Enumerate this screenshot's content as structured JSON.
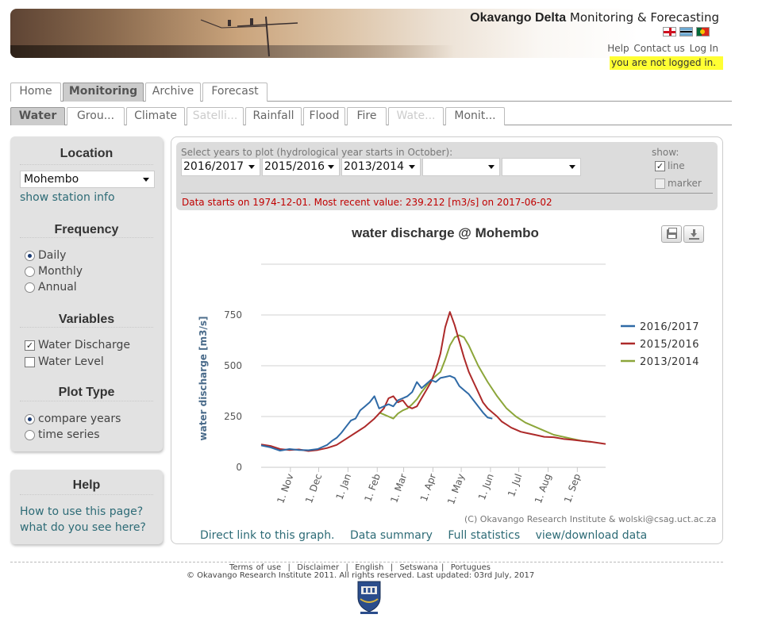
{
  "header": {
    "title_bold": "Okavango Delta",
    "title_rest": "Monitoring & Forecasting",
    "links": [
      "Help",
      "Contact us",
      "Log In"
    ],
    "login_status": "you are not logged in.",
    "flags": [
      "english-flag",
      "botswana-flag",
      "portugal-flag"
    ]
  },
  "main_tabs": [
    "Home",
    "Monitoring",
    "Archive",
    "Forecast"
  ],
  "main_tab_active": "Monitoring",
  "sub_tabs": [
    "Water",
    "Grou...",
    "Climate",
    "Satelli...",
    "Rainfall",
    "Flood",
    "Fire",
    "Wate...",
    "Monit..."
  ],
  "sub_tab_active": "Water",
  "sub_tabs_disabled": [
    "Satelli...",
    "Wate..."
  ],
  "sidebar": {
    "location": {
      "heading": "Location",
      "selected": "Mohembo",
      "link": "show station info"
    },
    "frequency": {
      "heading": "Frequency",
      "options": [
        "Daily",
        "Monthly",
        "Annual"
      ],
      "selected": "Daily"
    },
    "variables": {
      "heading": "Variables",
      "options": [
        {
          "label": "Water Discharge",
          "checked": true
        },
        {
          "label": "Water Level",
          "checked": false
        }
      ]
    },
    "plot_type": {
      "heading": "Plot Type",
      "options": [
        "compare years",
        "time series"
      ],
      "selected": "compare years"
    },
    "help": {
      "heading": "Help",
      "links": [
        "How to use this page?",
        "what do you see here?"
      ]
    }
  },
  "controls": {
    "label": "Select years to plot (hydrological year starts in October):",
    "years": [
      "2016/2017",
      "2015/2016",
      "2013/2014",
      "",
      ""
    ],
    "show_label": "show:",
    "show_options": [
      {
        "label": "line",
        "checked": true
      },
      {
        "label": "marker",
        "checked": false
      }
    ],
    "data_info": "Data starts on 1974-12-01. Most recent value: 239.212 [m3/s] on 2017-06-02"
  },
  "credit": "(C) Okavango Research Institute & wolski@csag.uct.ac.za",
  "content_links": [
    "Direct link to this graph.",
    "Data summary",
    "Full statistics",
    "view/download data"
  ],
  "footer": {
    "links": [
      "Terms of use",
      "Disclaimer",
      "English",
      "Setswana",
      "Portugues"
    ],
    "copyright": "© Okavango Research Institute 2011.  All rights reserved. Last updated: 03rd July, 2017"
  },
  "chart_data": {
    "type": "line",
    "title": "water discharge @ Mohembo",
    "ylabel": "water discharge [m3/s]",
    "ylim": [
      0,
      1000
    ],
    "yticks": [
      0,
      250,
      500,
      750
    ],
    "xrange_days": [
      0,
      365
    ],
    "xticks": [
      {
        "label": "1. Nov",
        "day": 31
      },
      {
        "label": "1. Dec",
        "day": 61
      },
      {
        "label": "1. Jan",
        "day": 92
      },
      {
        "label": "1. Feb",
        "day": 123
      },
      {
        "label": "1. Mar",
        "day": 151
      },
      {
        "label": "1. Apr",
        "day": 182
      },
      {
        "label": "1. May",
        "day": 212
      },
      {
        "label": "1. Jun",
        "day": 243
      },
      {
        "label": "1. Jul",
        "day": 273
      },
      {
        "label": "1. Aug",
        "day": 304
      },
      {
        "label": "1. Sep",
        "day": 335
      }
    ],
    "grid": true,
    "legend_position": "right",
    "series": [
      {
        "name": "2016/2017",
        "color": "#2f6aa6",
        "x": [
          0,
          10,
          20,
          30,
          40,
          50,
          60,
          70,
          75,
          80,
          85,
          90,
          95,
          100,
          105,
          110,
          115,
          120,
          125,
          130,
          135,
          140,
          145,
          150,
          155,
          160,
          165,
          170,
          175,
          180,
          185,
          190,
          195,
          200,
          205,
          210,
          215,
          220,
          225,
          230,
          235,
          240,
          245
        ],
        "y": [
          108,
          98,
          82,
          90,
          85,
          84,
          90,
          110,
          130,
          145,
          170,
          200,
          230,
          240,
          280,
          300,
          320,
          350,
          290,
          300,
          310,
          300,
          330,
          340,
          350,
          370,
          420,
          390,
          410,
          430,
          420,
          440,
          445,
          450,
          440,
          400,
          380,
          360,
          330,
          300,
          270,
          245,
          240
        ]
      },
      {
        "name": "2015/2016",
        "color": "#ad2a2a",
        "x": [
          0,
          10,
          20,
          30,
          40,
          50,
          60,
          70,
          80,
          90,
          100,
          110,
          120,
          130,
          135,
          140,
          145,
          150,
          155,
          160,
          165,
          170,
          175,
          180,
          185,
          190,
          195,
          200,
          205,
          210,
          215,
          220,
          225,
          230,
          235,
          240,
          245,
          250,
          255,
          260,
          265,
          270,
          275,
          280,
          290,
          300,
          310,
          320,
          330,
          340,
          350,
          360,
          365
        ],
        "y": [
          112,
          105,
          90,
          85,
          88,
          80,
          85,
          95,
          110,
          140,
          170,
          200,
          240,
          290,
          340,
          350,
          320,
          330,
          300,
          290,
          300,
          340,
          380,
          420,
          480,
          560,
          690,
          765,
          700,
          620,
          540,
          470,
          420,
          370,
          320,
          290,
          270,
          250,
          225,
          210,
          195,
          185,
          175,
          170,
          160,
          150,
          148,
          140,
          135,
          130,
          125,
          118,
          115
        ]
      },
      {
        "name": "2013/2014",
        "color": "#8ca63a",
        "x": [
          125,
          130,
          135,
          140,
          145,
          150,
          155,
          160,
          165,
          170,
          175,
          180,
          185,
          190,
          195,
          200,
          205,
          210,
          215,
          220,
          225,
          230,
          235,
          240,
          250,
          260,
          270,
          280,
          290,
          300,
          310,
          320,
          330,
          340,
          350
        ],
        "y": [
          270,
          260,
          250,
          240,
          265,
          280,
          290,
          310,
          335,
          370,
          400,
          430,
          450,
          470,
          530,
          600,
          640,
          650,
          640,
          600,
          550,
          500,
          460,
          420,
          350,
          290,
          250,
          220,
          200,
          180,
          160,
          150,
          140,
          130,
          125
        ]
      }
    ]
  }
}
